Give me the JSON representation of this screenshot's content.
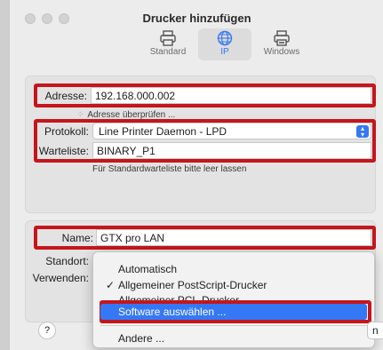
{
  "window": {
    "title": "Drucker hinzufügen"
  },
  "tabs": [
    {
      "label": "Standard",
      "icon": "printer-icon",
      "active": false
    },
    {
      "label": "IP",
      "icon": "globe-icon",
      "active": true
    },
    {
      "label": "Windows",
      "icon": "windows-printer-icon",
      "active": false
    }
  ],
  "form": {
    "address_label": "Adresse:",
    "address_value": "192.168.000.002",
    "address_check_hint": "Adresse überprüfen ...",
    "protocol_label": "Protokoll:",
    "protocol_value": "Line Printer Daemon - LPD",
    "queue_label": "Warteliste:",
    "queue_value": "BINARY_P1",
    "queue_hint": "Für Standardwarteliste bitte leer lassen",
    "name_label": "Name:",
    "name_value": "GTX pro LAN",
    "location_label": "Standort:",
    "use_label": "Verwenden:"
  },
  "use_menu": {
    "items": [
      {
        "label": "Automatisch",
        "checked": false,
        "selected": false
      },
      {
        "label": "Allgemeiner PostScript-Drucker",
        "checked": true,
        "selected": false
      },
      {
        "label": "Allgemeiner PCL-Drucker",
        "checked": false,
        "selected": false
      },
      {
        "label": "Software auswählen ...",
        "checked": false,
        "selected": true
      },
      {
        "label": "Andere ...",
        "checked": false,
        "selected": false
      }
    ]
  },
  "footer": {
    "help_label": "?",
    "right_button_label": "n"
  },
  "colors": {
    "highlight_border": "#c4161c",
    "accent": "#3478f6"
  }
}
